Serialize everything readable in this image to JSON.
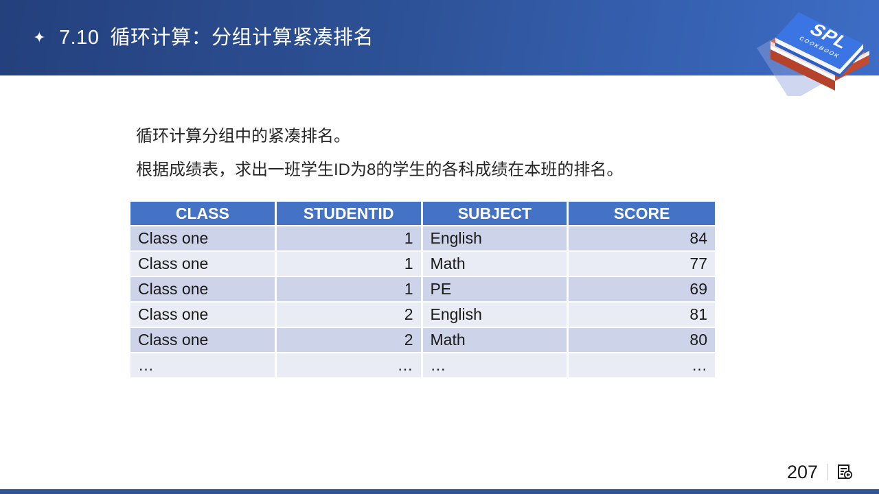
{
  "header": {
    "sparkle": "✦",
    "section_number": "7.10",
    "title": "循环计算：分组计算紧凑排名",
    "accent_dark": "#24407d",
    "accent_mid": "#2d5196",
    "accent_light": "#3d6dc6"
  },
  "logo": {
    "top_label": "SPL",
    "bottom_label": "COOKBOOK",
    "cover_color": "#3b74e3",
    "lower_book_color": "#c24a31"
  },
  "content": {
    "line1": "循环计算分组中的紧凑排名。",
    "line2": "根据成绩表，求出一班学生ID为8的学生的各科成绩在本班的排名。"
  },
  "table": {
    "header_bg": "#4472c4",
    "row_bg_odd": "#cdd3e8",
    "row_bg_even": "#e9ebf5",
    "columns": [
      "CLASS",
      "STUDENTID",
      "SUBJECT",
      "SCORE"
    ],
    "rows": [
      [
        "Class one",
        "1",
        "English",
        "84"
      ],
      [
        "Class one",
        "1",
        "Math",
        "77"
      ],
      [
        "Class one",
        "1",
        "PE",
        "69"
      ],
      [
        "Class one",
        "2",
        "English",
        "81"
      ],
      [
        "Class one",
        "2",
        "Math",
        "80"
      ],
      [
        "…",
        "…",
        "…",
        "…"
      ]
    ]
  },
  "footer": {
    "page_number": "207"
  }
}
